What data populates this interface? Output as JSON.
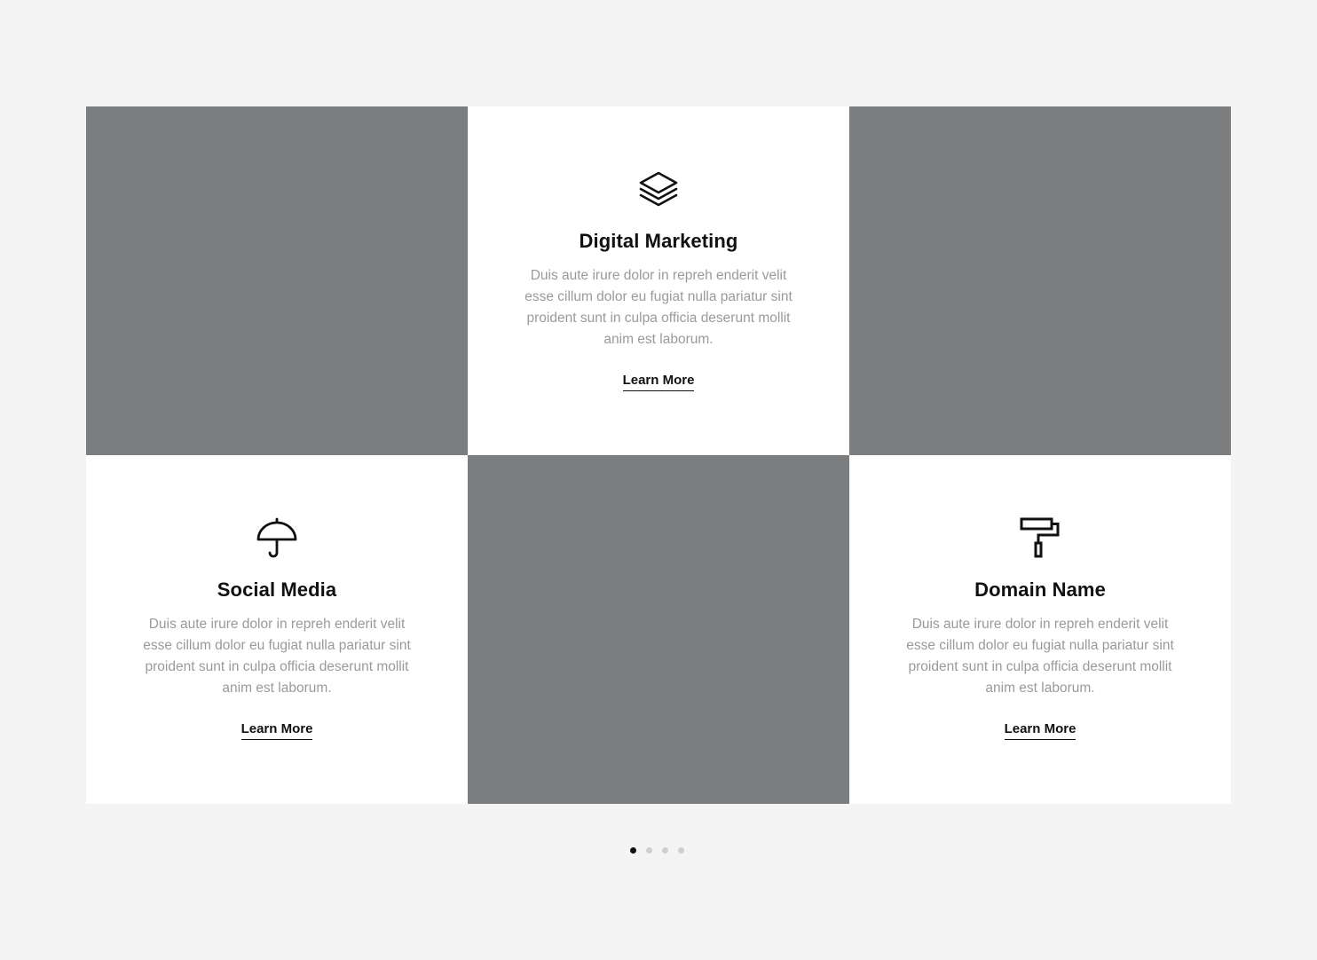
{
  "services": {
    "digital_marketing": {
      "icon": "layers-icon",
      "title": "Digital Marketing",
      "description": "Duis aute irure dolor in repreh enderit velit esse cillum dolor eu fugiat nulla pariatur sint proident sunt in culpa officia deserunt mollit anim est laborum.",
      "link_label": "Learn More"
    },
    "social_media": {
      "icon": "umbrella-icon",
      "title": "Social Media",
      "description": "Duis aute irure dolor in repreh enderit velit esse cillum dolor eu fugiat nulla pariatur sint proident sunt in culpa officia deserunt mollit anim est laborum.",
      "link_label": "Learn More"
    },
    "domain_name": {
      "icon": "paint-roller-icon",
      "title": "Domain Name",
      "description": "Duis aute irure dolor in repreh enderit velit esse cillum dolor eu fugiat nulla pariatur sint proident sunt in culpa officia deserunt mollit anim est laborum.",
      "link_label": "Learn More"
    }
  },
  "pagination": {
    "total_pages": 4,
    "active_page": 1
  },
  "colors": {
    "page_background": "#f4f4f4",
    "image_placeholder": "#7c7d7f",
    "card_background": "#ffffff",
    "text_dark": "#111111",
    "text_muted": "#9a9a9a",
    "dot_inactive": "#cfcfcf",
    "dot_active": "#111111"
  }
}
